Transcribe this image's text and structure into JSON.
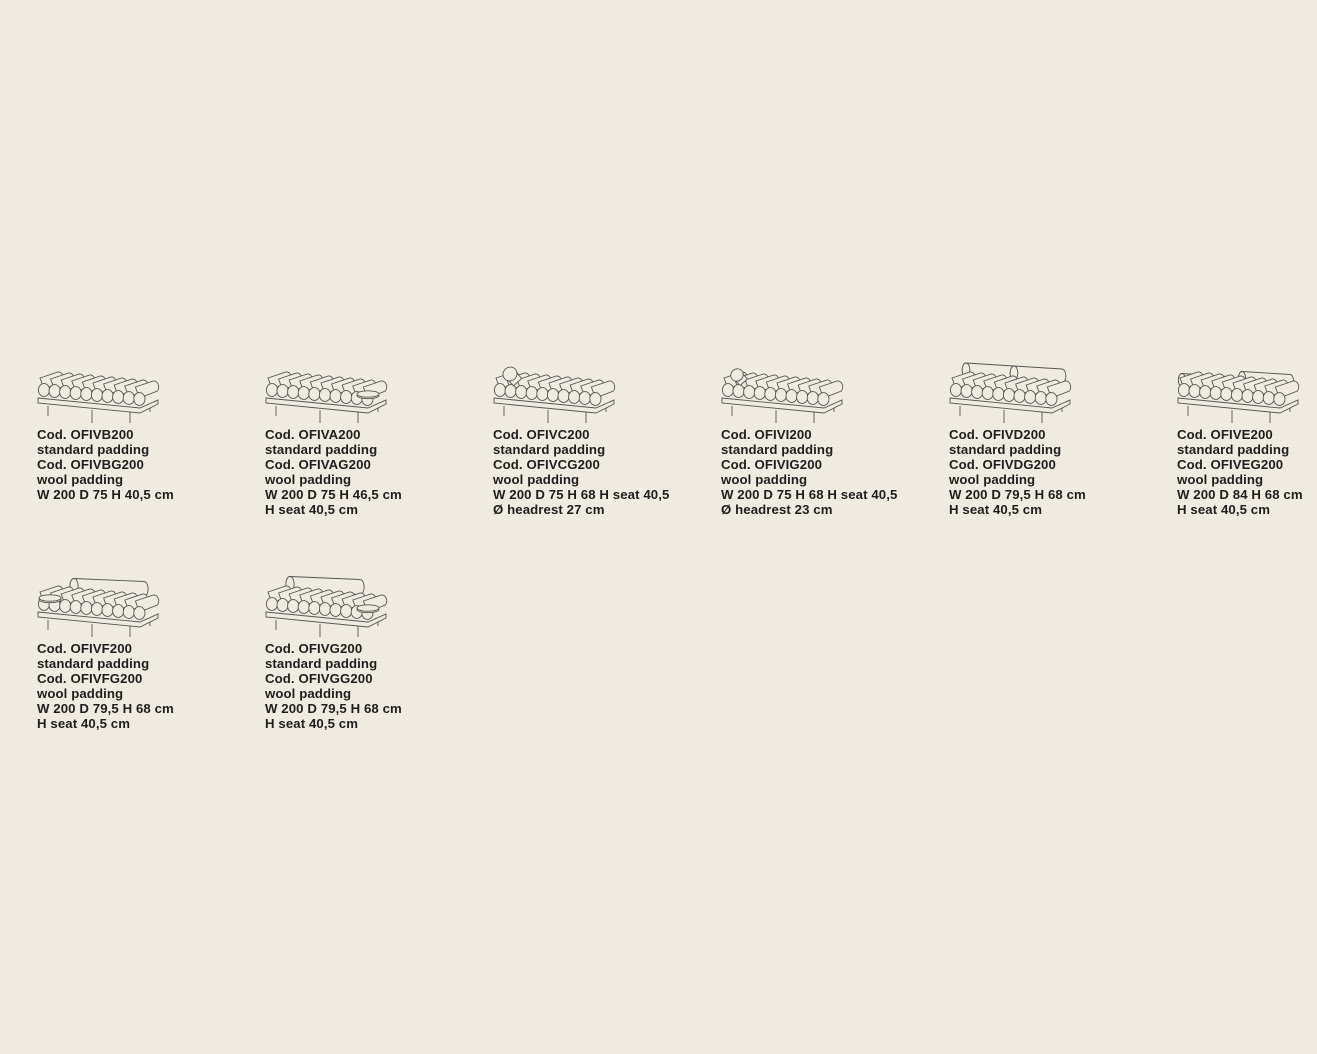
{
  "background_color": "#efebe0",
  "text_color": "#1e1e1e",
  "line_color": "#555555",
  "items": [
    {
      "drawing": "daybed-no-headrest-icon",
      "lines": [
        "Cod. OFIVB200",
        "standard padding",
        "Cod. OFIVBG200",
        "wool padding",
        "W 200 D 75 H 40,5 cm"
      ]
    },
    {
      "drawing": "daybed-with-side-tray-icon",
      "lines": [
        "Cod. OFIVA200",
        "standard padding",
        "Cod. OFIVAG200",
        "wool padding",
        "W 200 D 75 H 46,5 cm",
        "H seat 40,5 cm"
      ]
    },
    {
      "drawing": "daybed-with-large-headrest-icon",
      "lines": [
        "Cod. OFIVC200",
        "standard padding",
        "Cod. OFIVCG200",
        "wool padding",
        "W 200 D 75 H 68 H seat 40,5",
        "Ø headrest 27 cm"
      ]
    },
    {
      "drawing": "daybed-with-small-headrest-icon",
      "lines": [
        "Cod. OFIVI200",
        "standard padding",
        "Cod. OFIVIG200",
        "wool padding",
        "W 200 D 75 H 68 H seat 40,5",
        "Ø headrest 23 cm"
      ]
    },
    {
      "drawing": "daybed-with-long-backrest-icon",
      "lines": [
        "Cod. OFIVD200",
        "standard padding",
        "Cod. OFIVDG200",
        "wool padding",
        "W 200 D 79,5 H 68 cm",
        "H seat 40,5 cm"
      ]
    },
    {
      "drawing": "daybed-with-two-backrests-icon",
      "lines": [
        "Cod. OFIVE200",
        "standard padding",
        "Cod. OFIVEG200",
        "wool padding",
        "W 200 D 84 H 68 cm",
        "H seat 40,5 cm"
      ]
    },
    {
      "drawing": "daybed-backrest-left-tray-icon",
      "lines": [
        "Cod. OFIVF200",
        "standard padding",
        "Cod. OFIVFG200",
        "wool padding",
        "W 200 D 79,5 H 68 cm",
        "H seat 40,5 cm"
      ]
    },
    {
      "drawing": "daybed-backrest-right-tray-icon",
      "lines": [
        "Cod. OFIVG200",
        "standard padding",
        "Cod. OFIVGG200",
        "wool padding",
        "W 200 D 79,5 H 68 cm",
        "H seat 40,5 cm"
      ]
    }
  ]
}
